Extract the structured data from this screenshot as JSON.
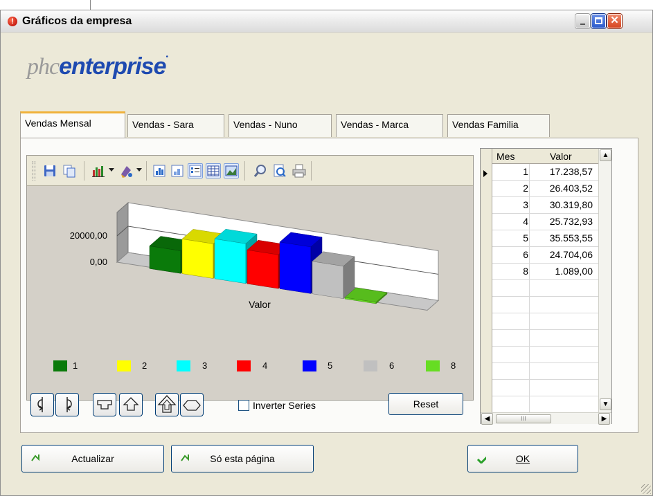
{
  "window": {
    "title": "Gráficos da empresa",
    "controls": [
      "minimize-icon",
      "maximize-icon",
      "close-icon"
    ]
  },
  "logo": {
    "light": "phc",
    "bold": "enterprise",
    "mark": "•"
  },
  "tabs": [
    {
      "label": "Vendas Mensal",
      "active": true
    },
    {
      "label": "Vendas - Sara",
      "active": false
    },
    {
      "label": "Vendas - Nuno",
      "active": false
    },
    {
      "label": "Vendas - Marca",
      "active": false
    },
    {
      "label": "Vendas Familia",
      "active": false
    }
  ],
  "toolbar": {
    "icons": [
      "save-icon",
      "copy-icon",
      "chart-type-icon",
      "palette-icon",
      "view-2d-icon",
      "view-3d-icon",
      "legend-icon",
      "data-grid-icon",
      "gallery-icon",
      "zoom-icon",
      "preview-icon",
      "print-icon"
    ]
  },
  "chart_data": {
    "type": "bar",
    "categories": [
      "1",
      "2",
      "3",
      "4",
      "5",
      "6",
      "8"
    ],
    "series": [
      {
        "name": "Valor",
        "values": [
          17238.57,
          26403.52,
          30319.8,
          25732.93,
          35553.55,
          24704.06,
          1089.0
        ]
      }
    ],
    "colors": [
      "#0a7a0a",
      "#ffff00",
      "#00ffff",
      "#ff0000",
      "#0000ff",
      "#c0c0c0",
      "#66dd22"
    ],
    "tick_labels": [
      "20000,00",
      "0,00"
    ],
    "xlabel": "Valor",
    "style": "3d",
    "legend": "bottom"
  },
  "legend_items": [
    {
      "label": "1",
      "color": "#0a7a0a"
    },
    {
      "label": "2",
      "color": "#ffff00"
    },
    {
      "label": "3",
      "color": "#00ffff"
    },
    {
      "label": "4",
      "color": "#ff0000"
    },
    {
      "label": "5",
      "color": "#0000ff"
    },
    {
      "label": "6",
      "color": "#c0c0c0"
    },
    {
      "label": "8",
      "color": "#66dd22"
    }
  ],
  "controls": {
    "rotate_buttons": [
      "rotate-left-icon",
      "rotate-right-icon",
      "tilt-down-icon",
      "tilt-up-icon",
      "perspective-up-icon",
      "flatten-icon"
    ],
    "invert_label": "Inverter Series",
    "invert_checked": false,
    "reset_label": "Reset"
  },
  "grid": {
    "headers": {
      "mes": "Mes",
      "valor": "Valor"
    },
    "rows": [
      {
        "mes": "1",
        "valor": "17.238,57"
      },
      {
        "mes": "2",
        "valor": "26.403,52"
      },
      {
        "mes": "3",
        "valor": "30.319,80"
      },
      {
        "mes": "4",
        "valor": "25.732,93"
      },
      {
        "mes": "5",
        "valor": "35.553,55"
      },
      {
        "mes": "6",
        "valor": "24.704,06"
      },
      {
        "mes": "8",
        "valor": "1.089,00"
      }
    ],
    "hthumb": "III"
  },
  "footer": {
    "actualizar": "Actualizar",
    "so_esta": "Só esta página",
    "ok": "OK"
  }
}
